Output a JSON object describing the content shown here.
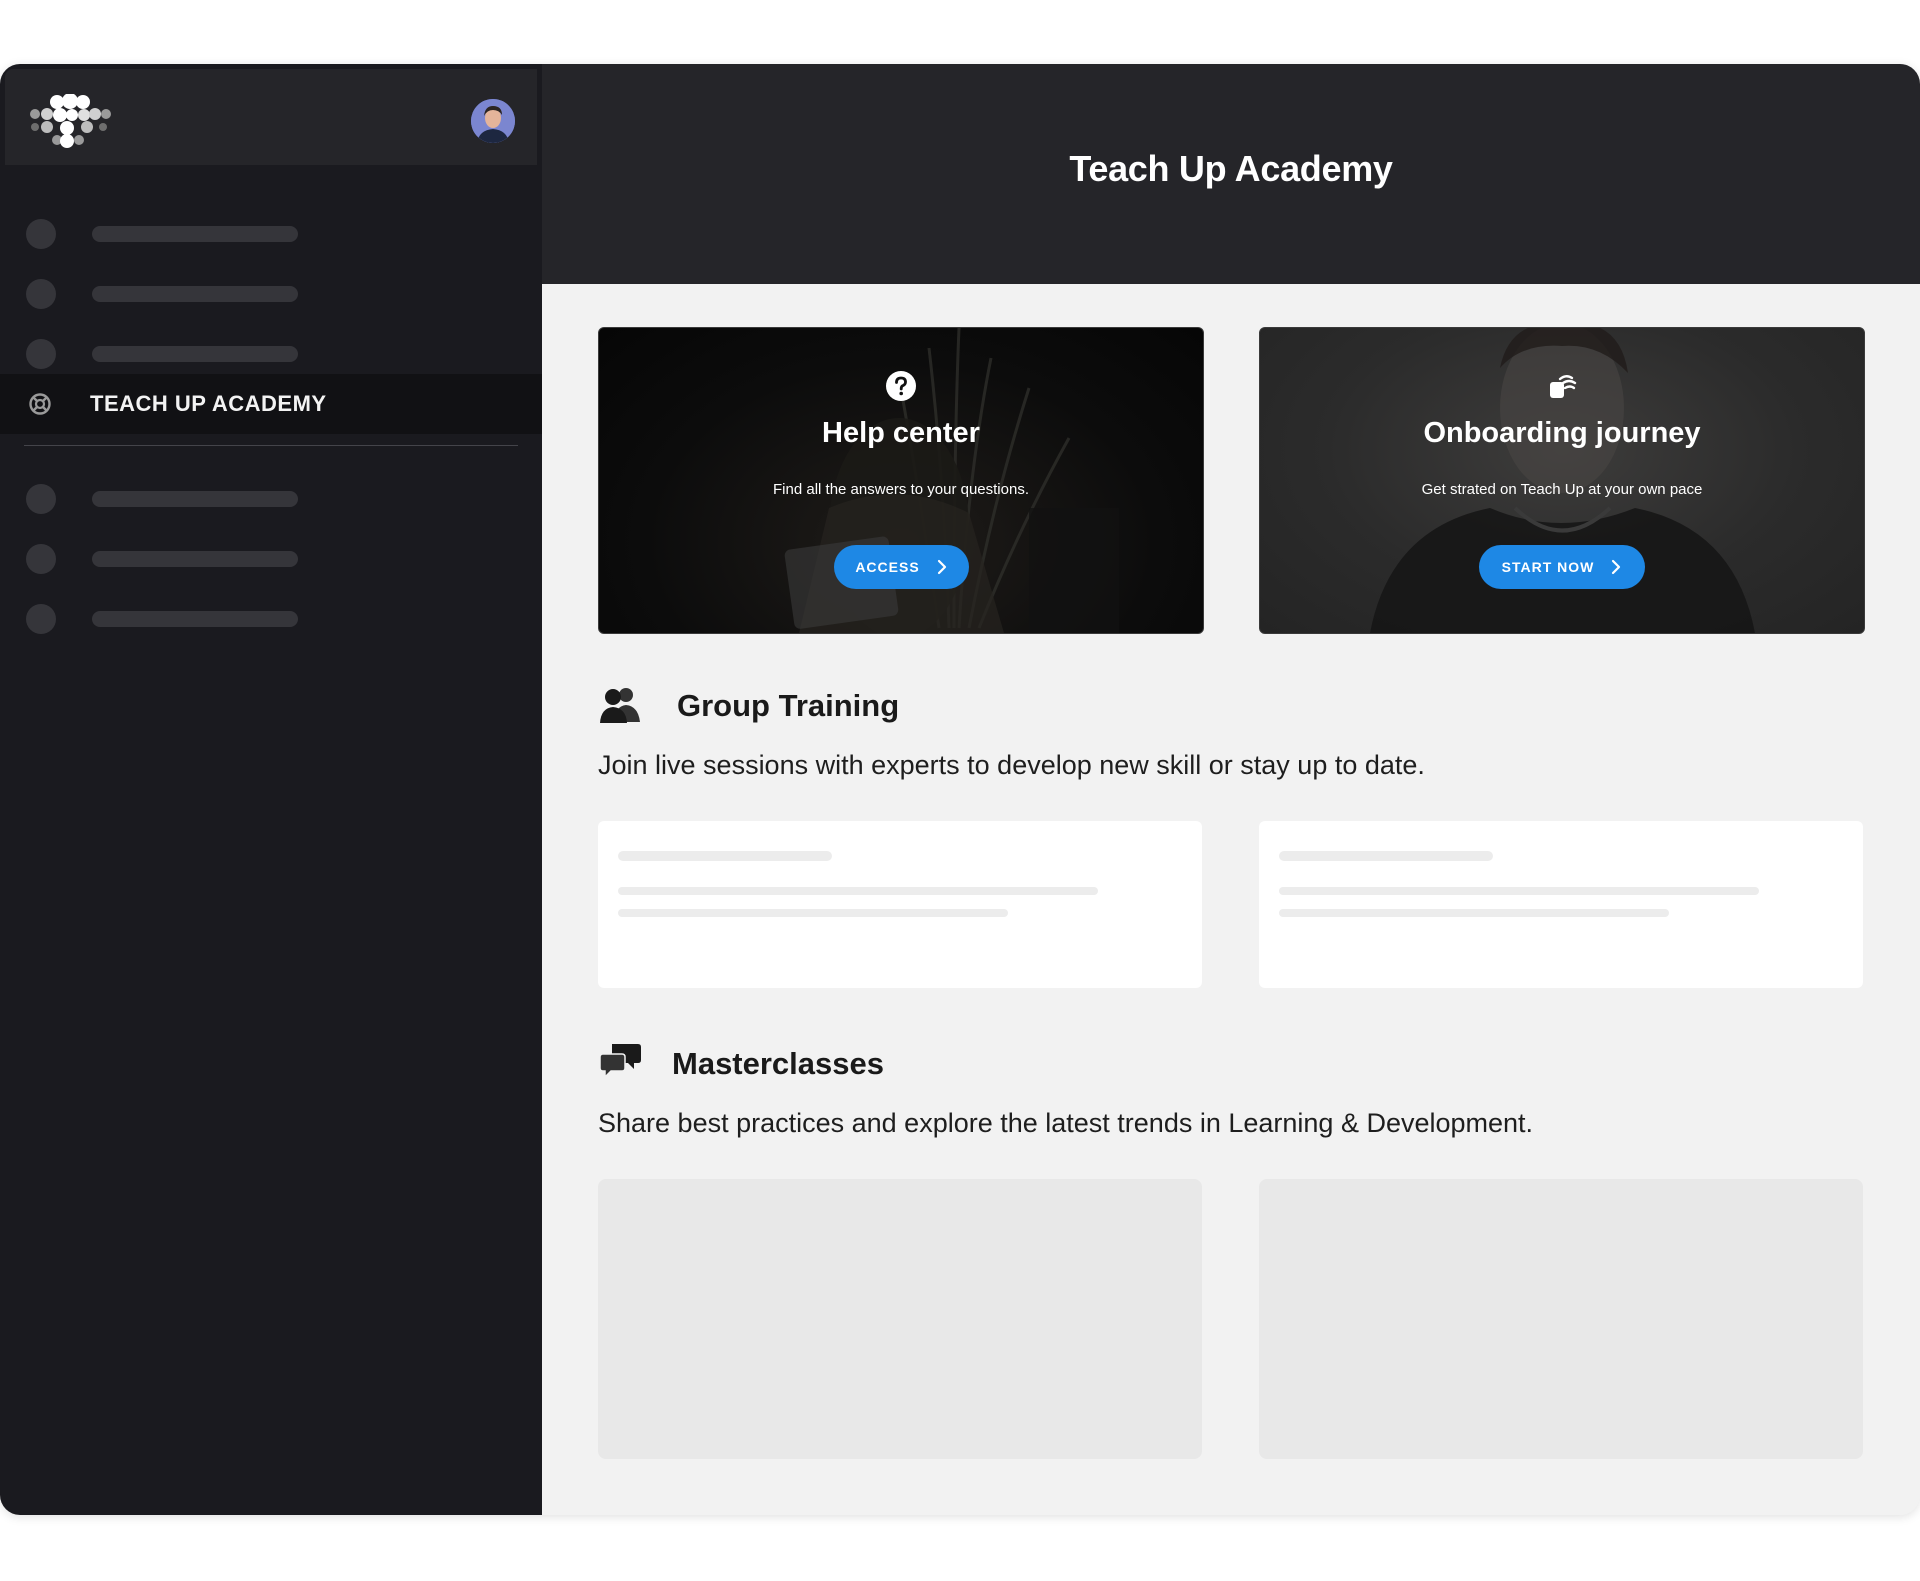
{
  "app": {
    "title": "Teach Up Academy"
  },
  "sidebar": {
    "active_item": {
      "label": "TEACH UP ACADEMY",
      "icon": "lifebuoy-icon"
    }
  },
  "hero_cards": [
    {
      "title": "Help center",
      "subtitle": "Find all the answers to your questions.",
      "button": "ACCESS",
      "icon": "question-circle-icon"
    },
    {
      "title": "Onboarding journey",
      "subtitle": "Get strated on Teach Up at your own pace",
      "button": "START NOW",
      "icon": "cards-stack-icon"
    }
  ],
  "sections": {
    "group_training": {
      "title": "Group Training",
      "description": "Join live sessions with experts to develop new skill or stay up to date.",
      "icon": "users-icon"
    },
    "masterclasses": {
      "title": "Masterclasses",
      "description": "Share best practices and explore the latest trends in Learning & Development.",
      "icon": "chat-bubbles-icon"
    }
  },
  "colors": {
    "accent": "#1e88e5",
    "sidebar_bg": "#1a1a1f",
    "header_bg": "#252529",
    "content_bg": "#f2f2f2"
  }
}
